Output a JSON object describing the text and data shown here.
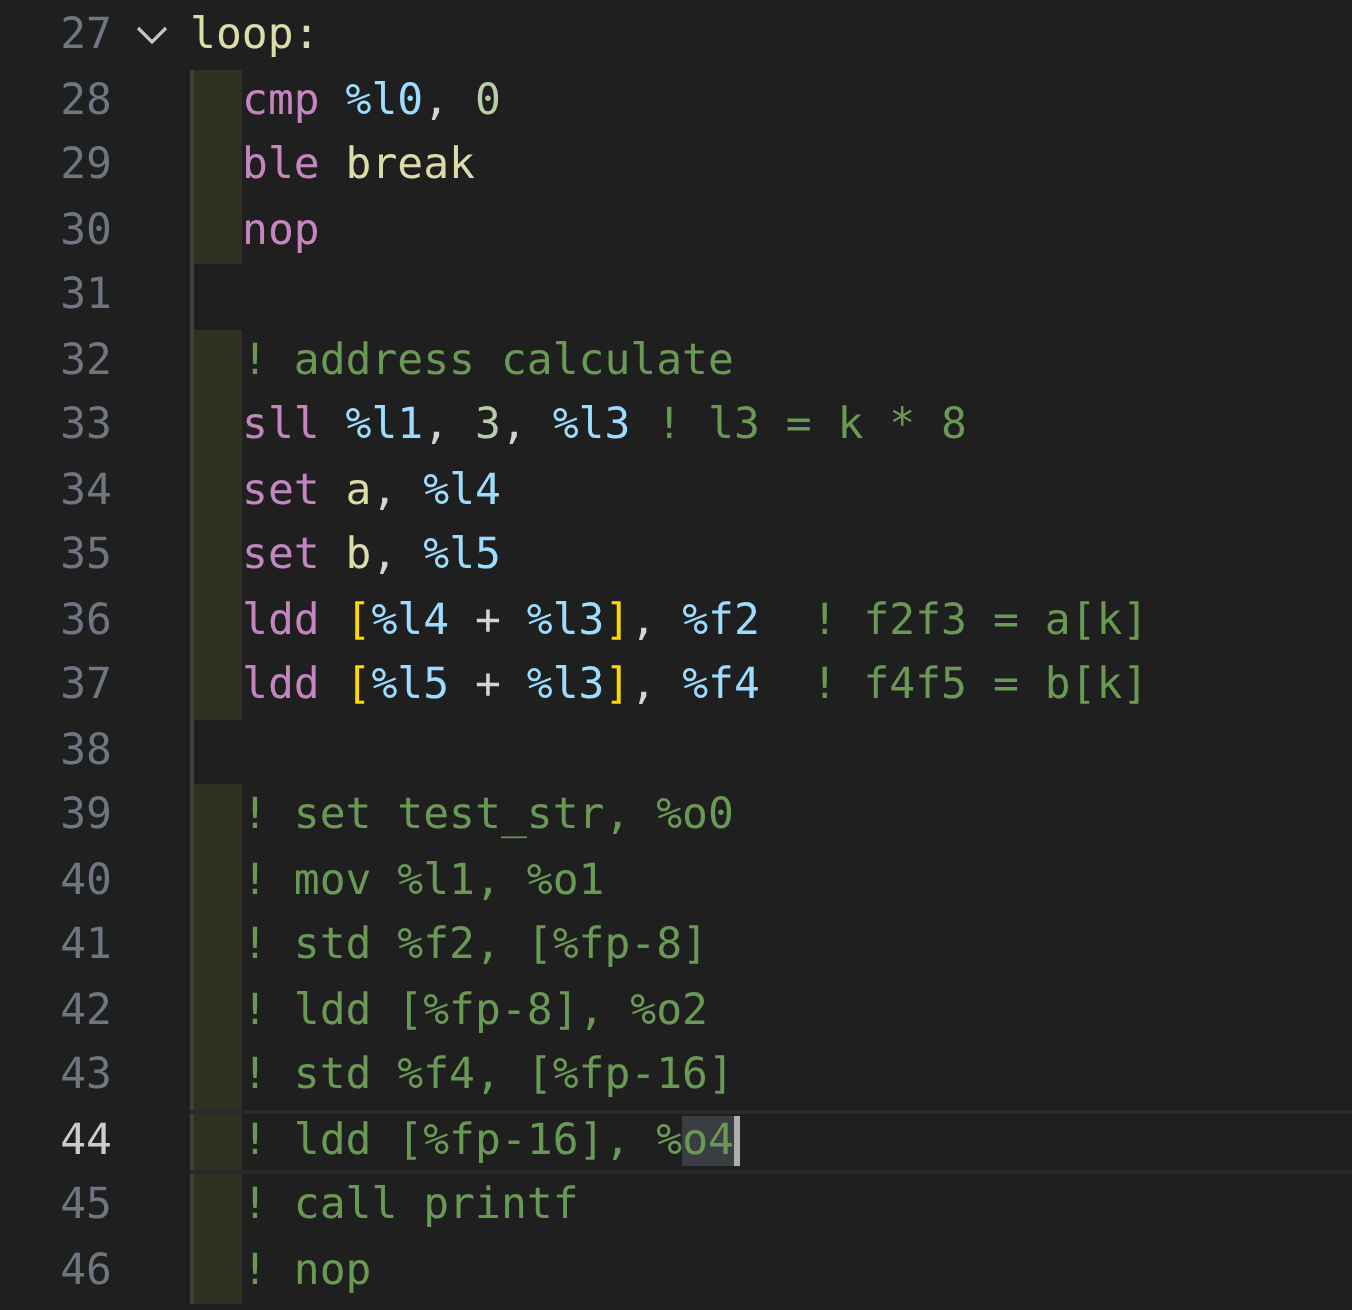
{
  "lines": [
    {
      "number": "27",
      "current": false,
      "fold": {
        "expanded": true
      },
      "tokens": [
        {
          "kind": "label",
          "text": "loop:"
        }
      ]
    },
    {
      "number": "28",
      "current": false,
      "indent": true,
      "tokens": [
        {
          "kind": "keyword",
          "text": "cmp "
        },
        {
          "kind": "register",
          "text": "%l0"
        },
        {
          "kind": "plain",
          "text": ", "
        },
        {
          "kind": "number",
          "text": "0"
        }
      ]
    },
    {
      "number": "29",
      "current": false,
      "indent": true,
      "tokens": [
        {
          "kind": "keyword",
          "text": "ble "
        },
        {
          "kind": "label",
          "text": "break"
        }
      ]
    },
    {
      "number": "30",
      "current": false,
      "indent": true,
      "tokens": [
        {
          "kind": "keyword",
          "text": "nop"
        }
      ]
    },
    {
      "number": "31",
      "current": false,
      "indent": false
    },
    {
      "number": "32",
      "current": false,
      "indent": true,
      "tokens": [
        {
          "kind": "comment",
          "text": "! address calculate"
        }
      ]
    },
    {
      "number": "33",
      "current": false,
      "indent": true,
      "tokens": [
        {
          "kind": "keyword",
          "text": "sll "
        },
        {
          "kind": "register",
          "text": "%l1"
        },
        {
          "kind": "plain",
          "text": ", "
        },
        {
          "kind": "number",
          "text": "3"
        },
        {
          "kind": "plain",
          "text": ", "
        },
        {
          "kind": "register",
          "text": "%l3"
        },
        {
          "kind": "comment",
          "text": " ! l3 = k * 8"
        }
      ]
    },
    {
      "number": "34",
      "current": false,
      "indent": true,
      "tokens": [
        {
          "kind": "keyword",
          "text": "set "
        },
        {
          "kind": "label",
          "text": "a"
        },
        {
          "kind": "plain",
          "text": ", "
        },
        {
          "kind": "register",
          "text": "%l4"
        }
      ]
    },
    {
      "number": "35",
      "current": false,
      "indent": true,
      "tokens": [
        {
          "kind": "keyword",
          "text": "set "
        },
        {
          "kind": "label",
          "text": "b"
        },
        {
          "kind": "plain",
          "text": ", "
        },
        {
          "kind": "register",
          "text": "%l5"
        }
      ]
    },
    {
      "number": "36",
      "current": false,
      "indent": true,
      "tokens": [
        {
          "kind": "keyword",
          "text": "ldd "
        },
        {
          "kind": "bracket",
          "text": "["
        },
        {
          "kind": "register",
          "text": "%l4"
        },
        {
          "kind": "plain",
          "text": " + "
        },
        {
          "kind": "register",
          "text": "%l3"
        },
        {
          "kind": "bracket",
          "text": "]"
        },
        {
          "kind": "plain",
          "text": ", "
        },
        {
          "kind": "register",
          "text": "%f2"
        },
        {
          "kind": "comment",
          "text": "  ! f2f3 = a[k]"
        }
      ]
    },
    {
      "number": "37",
      "current": false,
      "indent": true,
      "tokens": [
        {
          "kind": "keyword",
          "text": "ldd "
        },
        {
          "kind": "bracket",
          "text": "["
        },
        {
          "kind": "register",
          "text": "%l5"
        },
        {
          "kind": "plain",
          "text": " + "
        },
        {
          "kind": "register",
          "text": "%l3"
        },
        {
          "kind": "bracket",
          "text": "]"
        },
        {
          "kind": "plain",
          "text": ", "
        },
        {
          "kind": "register",
          "text": "%f4"
        },
        {
          "kind": "comment",
          "text": "  ! f4f5 = b[k]"
        }
      ]
    },
    {
      "number": "38",
      "current": false,
      "indent": false
    },
    {
      "number": "39",
      "current": false,
      "indent": true,
      "tokens": [
        {
          "kind": "comment",
          "text": "! set test_str, %o0"
        }
      ]
    },
    {
      "number": "40",
      "current": false,
      "indent": true,
      "tokens": [
        {
          "kind": "comment",
          "text": "! mov %l1, %o1"
        }
      ]
    },
    {
      "number": "41",
      "current": false,
      "indent": true,
      "tokens": [
        {
          "kind": "comment",
          "text": "! std %f2, [%fp-8]"
        }
      ]
    },
    {
      "number": "42",
      "current": false,
      "indent": true,
      "tokens": [
        {
          "kind": "comment",
          "text": "! ldd [%fp-8], %o2"
        }
      ]
    },
    {
      "number": "43",
      "current": false,
      "indent": true,
      "tokens": [
        {
          "kind": "comment",
          "text": "! std %f4, [%fp-16]"
        }
      ]
    },
    {
      "number": "44",
      "current": true,
      "indent": true,
      "tokens": [
        {
          "kind": "comment",
          "text": "! ldd [%fp-16], %"
        },
        {
          "kind": "comment",
          "text": "o4",
          "highlighted": true,
          "cursor": true
        }
      ]
    },
    {
      "number": "45",
      "current": false,
      "indent": true,
      "tokens": [
        {
          "kind": "comment",
          "text": "! call printf"
        }
      ]
    },
    {
      "number": "46",
      "current": false,
      "indent": true,
      "tokens": [
        {
          "kind": "comment",
          "text": "! nop"
        }
      ]
    }
  ]
}
